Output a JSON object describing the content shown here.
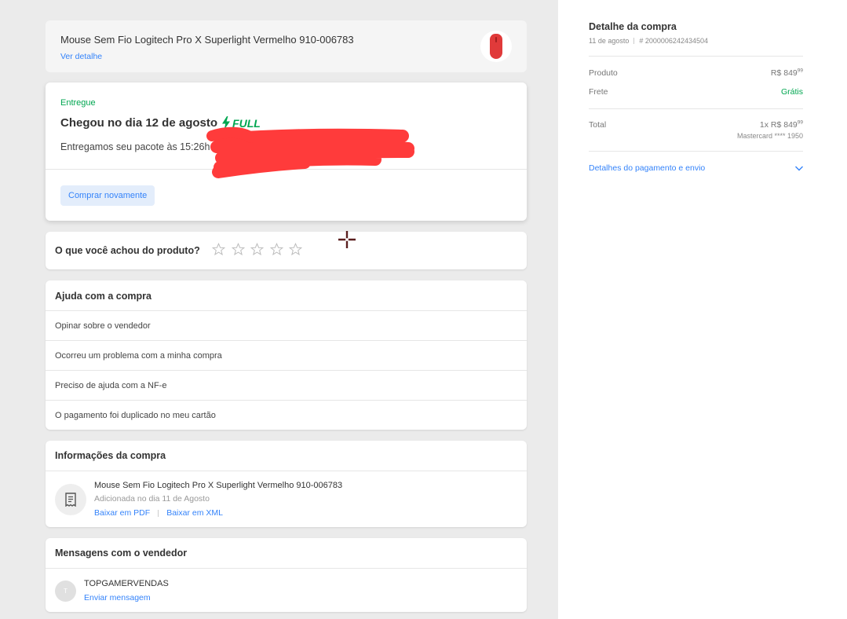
{
  "product": {
    "title": "Mouse Sem Fio Logitech Pro X Superlight Vermelho 910-006783",
    "detail_link": "Ver detalhe",
    "thumbnail_icon": "red-mouse-image"
  },
  "delivery": {
    "status": "Entregue",
    "headline": "Chegou no dia 12 de agosto",
    "badge": "FULL",
    "description": "Entregamos seu pacote às 15:26h em                                                              io, São Paulo.",
    "buy_again": "Comprar novamente",
    "accent_color": "#00a650"
  },
  "rating": {
    "question": "O que você achou do produto?",
    "stars": 5,
    "filled": 0
  },
  "help": {
    "title": "Ajuda com a compra",
    "items": [
      "Opinar sobre o vendedor",
      "Ocorreu um problema com a minha compra",
      "Preciso de ajuda com a NF-e",
      "O pagamento foi duplicado no meu cartão"
    ]
  },
  "info": {
    "title": "Informações da compra",
    "product_title": "Mouse Sem Fio Logitech Pro X Superlight Vermelho 910-006783",
    "added": "Adicionada no dia 11 de Agosto",
    "pdf_link": "Baixar em PDF",
    "xml_link": "Baixar em XML"
  },
  "messages": {
    "title": "Mensagens com o vendedor",
    "avatar_initial": "T",
    "seller": "TOPGAMERVENDAS",
    "send_link": "Enviar mensagem"
  },
  "summary": {
    "title": "Detalhe da compra",
    "date": "11 de agosto",
    "order": "# 2000006242434504",
    "product_label": "Produto",
    "product_price": "R$ 849",
    "product_cents": "99",
    "shipping_label": "Frete",
    "shipping_value": "Grátis",
    "total_label": "Total",
    "total_value": "1x R$ 849",
    "total_cents": "99",
    "card": "Mastercard **** 1950",
    "payment_link": "Detalhes do pagamento e envio"
  },
  "colors": {
    "link": "#3483fa",
    "success": "#00a650",
    "redaction": "#ff3b3b"
  }
}
